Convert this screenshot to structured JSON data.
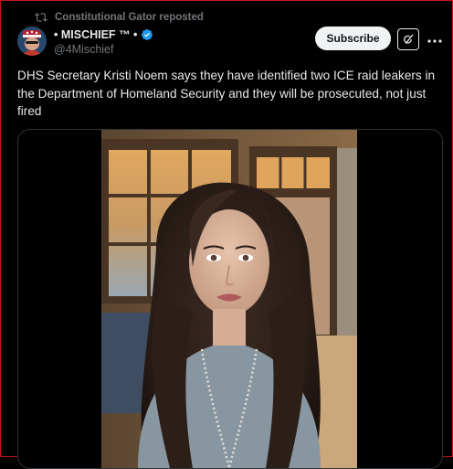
{
  "repost": {
    "label": "Constitutional Gator reposted",
    "icon": "repost-icon"
  },
  "author": {
    "display_name": "• MISCHIEF ™ •",
    "handle": "@4Mischief",
    "verified": true,
    "verified_color": "#1d9bf0"
  },
  "actions": {
    "subscribe_label": "Subscribe",
    "grok_icon": "grok-icon",
    "more_icon": "more-icon"
  },
  "tweet": {
    "text": "DHS Secretary Kristi Noem says they have identified two ICE raid leakers in the Department of Homeland Security and they will be prosecuted, not just fired"
  },
  "media": {
    "type": "video",
    "icon": "video-thumbnail"
  },
  "colors": {
    "background": "#000000",
    "text_primary": "#e7e9ea",
    "text_secondary": "#71767b",
    "subscribe_bg": "#eff3f4",
    "border": "#2f3336",
    "frame_border": "#c4161c"
  }
}
